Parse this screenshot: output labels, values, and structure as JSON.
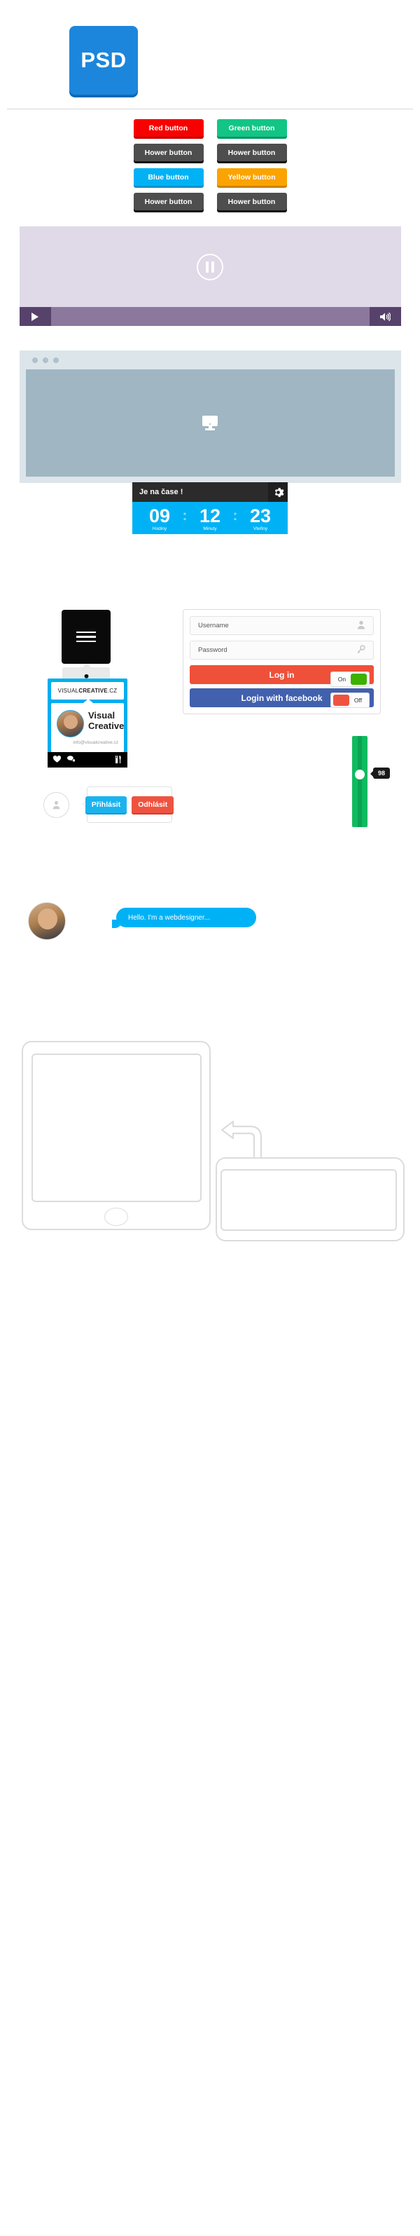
{
  "badge": {
    "label": "PSD",
    "color": "#1c86dd",
    "shadow_color": "#0f68b3"
  },
  "buttons": {
    "rows": [
      [
        {
          "label": "Red button",
          "style": "red",
          "color": "#f80000"
        },
        {
          "label": "Green button",
          "style": "green",
          "color": "#12c585"
        }
      ],
      [
        {
          "label": "Hower button",
          "style": "hover",
          "color": "#4e4e4e"
        },
        {
          "label": "Hower button",
          "style": "hover",
          "color": "#4e4e4e"
        }
      ],
      [
        {
          "label": "Blue button",
          "style": "blue",
          "color": "#00b2f5"
        },
        {
          "label": "Yellow button",
          "style": "yellow",
          "color": "#fba300"
        }
      ],
      [
        {
          "label": "Hower button",
          "style": "hover",
          "color": "#4e4e4e"
        },
        {
          "label": "Hower button",
          "style": "hover",
          "color": "#4e4e4e"
        }
      ]
    ]
  },
  "video_player": {
    "screen_color": "#e0d9e8",
    "bar_color": "#8b789c",
    "control_color": "#57426b",
    "center_icon": "pause-icon",
    "play_icon": "play-icon",
    "volume_icon": "volume-icon"
  },
  "browser_mockup": {
    "chrome_color": "#dce5ea",
    "viewport_color": "#a0b6c3",
    "dots": 3,
    "center_icon": "monitor-icon"
  },
  "countdown": {
    "title": "Je na čase !",
    "gear_icon": "gear-icon",
    "accent": "#00b2f5",
    "header_color": "#2b2b2b",
    "separator": ":",
    "units": [
      {
        "value": "09",
        "label": "Hodiny"
      },
      {
        "value": "12",
        "label": "Minuty"
      },
      {
        "value": "23",
        "label": "Vteřiny"
      }
    ]
  },
  "login": {
    "menu_icon": "hamburger-icon",
    "side_icons": [
      {
        "name": "user-icon",
        "glyph": "♟"
      },
      {
        "name": "gear-icon",
        "glyph": "⚙"
      },
      {
        "name": "mail-icon",
        "glyph": "✉"
      }
    ],
    "username": {
      "value": "",
      "placeholder": "Username",
      "icon": "user-icon"
    },
    "password": {
      "value": "",
      "placeholder": "Password",
      "icon": "key-icon"
    },
    "submit_label": "Log in",
    "submit_color": "#ef503a",
    "facebook_label": "Login with facebook",
    "facebook_color": "#4160ae"
  },
  "vcard": {
    "logo_prefix": "VISUAL",
    "logo_bold": "CREATIVE",
    "logo_suffix": ".CZ",
    "name_line1": "Visual",
    "name_line2": "Creative",
    "email": "info@visualcreative.cz",
    "border_color": "#00aeef",
    "footer_icons": [
      {
        "name": "heart-icon",
        "glyph": "♥"
      },
      {
        "name": "comment-icon",
        "glyph": "◕"
      },
      {
        "name": "tools-icon",
        "glyph": "⚒"
      }
    ]
  },
  "toggles": [
    {
      "label": "On",
      "state": "on",
      "knob_color": "#3db000"
    },
    {
      "label": "Off",
      "state": "off",
      "knob_color": "#ef5340"
    }
  ],
  "slider": {
    "value": "98",
    "track_color": "#0fbb5f",
    "min": 0,
    "max": 100
  },
  "prompt": {
    "avatar_icon": "user-icon",
    "login_label": "Přihlásit",
    "login_color": "#1ab3ef",
    "logout_label": "Odhlásit",
    "logout_color": "#ef5340"
  },
  "chat": {
    "avatar_icon": "avatar-photo",
    "message": "Hello. I'm a webdesigner...",
    "bubble_color": "#00b2f5"
  },
  "devices": {
    "rotate_icon": "rotate-arrow-icon",
    "outline_color": "#dcdcdc",
    "portrait_label": "tablet-portrait",
    "landscape_label": "tablet-landscape"
  }
}
